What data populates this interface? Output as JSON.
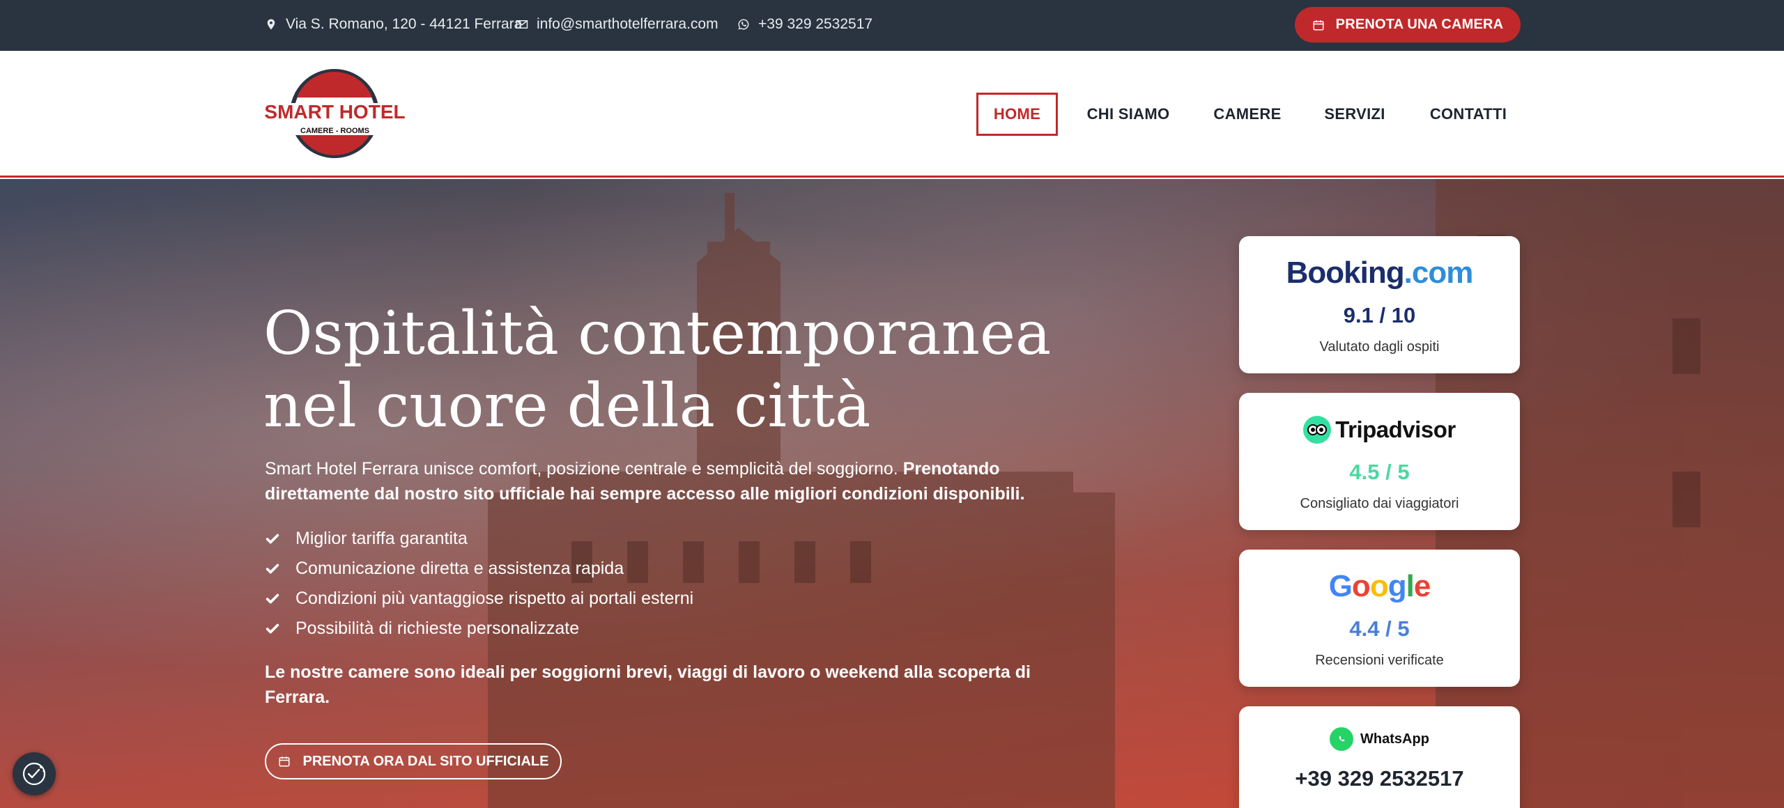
{
  "topbar": {
    "address": "Via S. Romano, 120 - 44121 Ferrara",
    "email": "info@smarthotelferrara.com",
    "phone": "+39 329 2532517",
    "book_label": "PRENOTA UNA CAMERA"
  },
  "logo": {
    "name": "SMART HOTEL",
    "tagline": "CAMERE - ROOMS"
  },
  "nav": {
    "items": [
      {
        "label": "HOME",
        "active": true
      },
      {
        "label": "CHI SIAMO"
      },
      {
        "label": "CAMERE"
      },
      {
        "label": "SERVIZI"
      },
      {
        "label": "CONTATTI"
      }
    ]
  },
  "hero": {
    "title": "Ospitalità contemporanea nel cuore della città",
    "lead_plain": "Smart Hotel Ferrara unisce comfort, posizione centrale e semplicità del soggiorno. ",
    "lead_bold": "Prenotando direttamente dal nostro sito ufficiale hai sempre accesso alle migliori condizioni disponibili.",
    "checks": [
      "Miglior tariffa garantita",
      "Comunicazione diretta e assistenza rapida",
      "Condizioni più vantaggiose rispetto ai portali esterni",
      "Possibilità di richieste personalizzate"
    ],
    "note": "Le nostre camere sono ideali per soggiorni brevi, viaggi di lavoro o weekend alla scoperta di Ferrara.",
    "cta_label": "PRENOTA ORA DAL SITO UFFICIALE"
  },
  "reviews": {
    "booking": {
      "brand_main": "Booking",
      "brand_dot": ".com",
      "score": "9.1 / 10",
      "subtitle": "Valutato dagli ospiti"
    },
    "tripadvisor": {
      "brand": "Tripadvisor",
      "score": "4.5 / 5",
      "subtitle": "Consigliato dai viaggiatori"
    },
    "google": {
      "brand_letters": [
        "G",
        "o",
        "o",
        "g",
        "l",
        "e"
      ],
      "score": "4.4 / 5",
      "subtitle": "Recensioni verificate"
    },
    "whatsapp": {
      "brand": "WhatsApp",
      "number": "+39 329 2532517"
    }
  },
  "colors": {
    "topbar_bg": "#2a3340",
    "accent_red": "#c0292b",
    "booking_navy": "#1b2d6b",
    "tripadvisor_green": "#34e0a1",
    "whatsapp_green": "#25d366"
  },
  "icons": {
    "address": "map-pin-icon",
    "email": "envelope-icon",
    "phone": "whatsapp-icon",
    "book": "calendar-icon",
    "check": "check-icon",
    "cookie": "cookie-settings-icon"
  }
}
